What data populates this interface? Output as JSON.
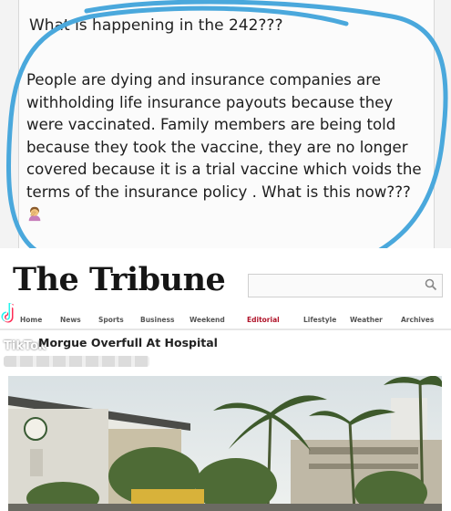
{
  "post": {
    "title": "What is happening in the 242???",
    "body": "People are dying and insurance companies are withholding life insurance payouts because they were vaccinated. Family members are being told because they took the vaccine, they are no longer covered because it is a trial vaccine which voids the terms of the insurance policy . What is this now???",
    "emoji": "woman-facepalming-emoji"
  },
  "article": {
    "masthead": "The Tribune",
    "nav": [
      "Home",
      "News",
      "Sports",
      "Business",
      "Weekend",
      "Editorial",
      "Lifestyle",
      "Weather",
      "Archives"
    ],
    "headline": "Morgue Overfull At Hospital",
    "watermark": "TikTok"
  },
  "colors": {
    "circle": "#4aa8dc",
    "editorial_link": "#b0142a"
  }
}
